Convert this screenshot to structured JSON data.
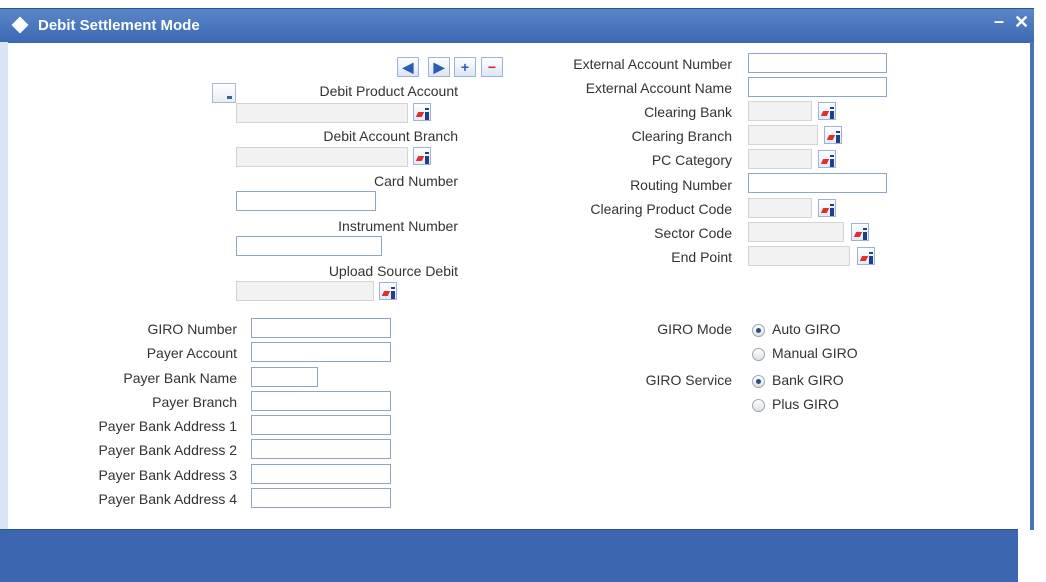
{
  "window": {
    "title": "Debit Settlement Mode",
    "minimize_glyph": "–",
    "close_glyph": "✕"
  },
  "nav": {
    "prev": "◀",
    "next": "▶",
    "add": "+",
    "remove": "−"
  },
  "left_form": {
    "debit_product_account": {
      "label": "Debit Product Account",
      "value": ""
    },
    "debit_account_branch": {
      "label": "Debit Account Branch",
      "value": ""
    },
    "card_number": {
      "label": "Card Number",
      "value": ""
    },
    "instrument_number": {
      "label": "Instrument Number",
      "value": ""
    },
    "upload_source_debit": {
      "label": "Upload Source Debit",
      "value": ""
    }
  },
  "right_form": {
    "external_account_number": {
      "label": "External Account Number",
      "value": ""
    },
    "external_account_name": {
      "label": "External Account Name",
      "value": ""
    },
    "clearing_bank": {
      "label": "Clearing Bank",
      "value": ""
    },
    "clearing_branch": {
      "label": "Clearing Branch",
      "value": ""
    },
    "pc_category": {
      "label": "PC Category",
      "value": ""
    },
    "routing_number": {
      "label": "Routing Number",
      "value": ""
    },
    "clearing_product_code": {
      "label": "Clearing Product Code",
      "value": ""
    },
    "sector_code": {
      "label": "Sector Code",
      "value": ""
    },
    "end_point": {
      "label": "End Point",
      "value": ""
    }
  },
  "giro_form": {
    "giro_number": {
      "label": "GIRO Number",
      "value": ""
    },
    "payer_account": {
      "label": "Payer Account",
      "value": ""
    },
    "payer_bank_name": {
      "label": "Payer Bank Name",
      "value": ""
    },
    "payer_branch": {
      "label": "Payer Branch",
      "value": ""
    },
    "payer_bank_address_1": {
      "label": "Payer Bank Address 1",
      "value": ""
    },
    "payer_bank_address_2": {
      "label": "Payer Bank Address 2",
      "value": ""
    },
    "payer_bank_address_3": {
      "label": "Payer Bank Address 3",
      "value": ""
    },
    "payer_bank_address_4": {
      "label": "Payer Bank Address 4",
      "value": ""
    }
  },
  "giro_options": {
    "mode": {
      "label": "GIRO Mode",
      "options": [
        "Auto GIRO",
        "Manual GIRO"
      ],
      "selected": "Auto GIRO"
    },
    "service": {
      "label": "GIRO Service",
      "options": [
        "Bank GIRO",
        "Plus GIRO"
      ],
      "selected": "Bank GIRO"
    }
  },
  "icons": {
    "title_icon": "diamond-icon",
    "lov_icon": "list-of-values-icon",
    "doc_icon": "document-icon"
  },
  "colors": {
    "titlebar": "#3b68b3",
    "footer": "#3d66b0",
    "accent_red": "#e0302b",
    "accent_blue": "#2d5bb7"
  }
}
